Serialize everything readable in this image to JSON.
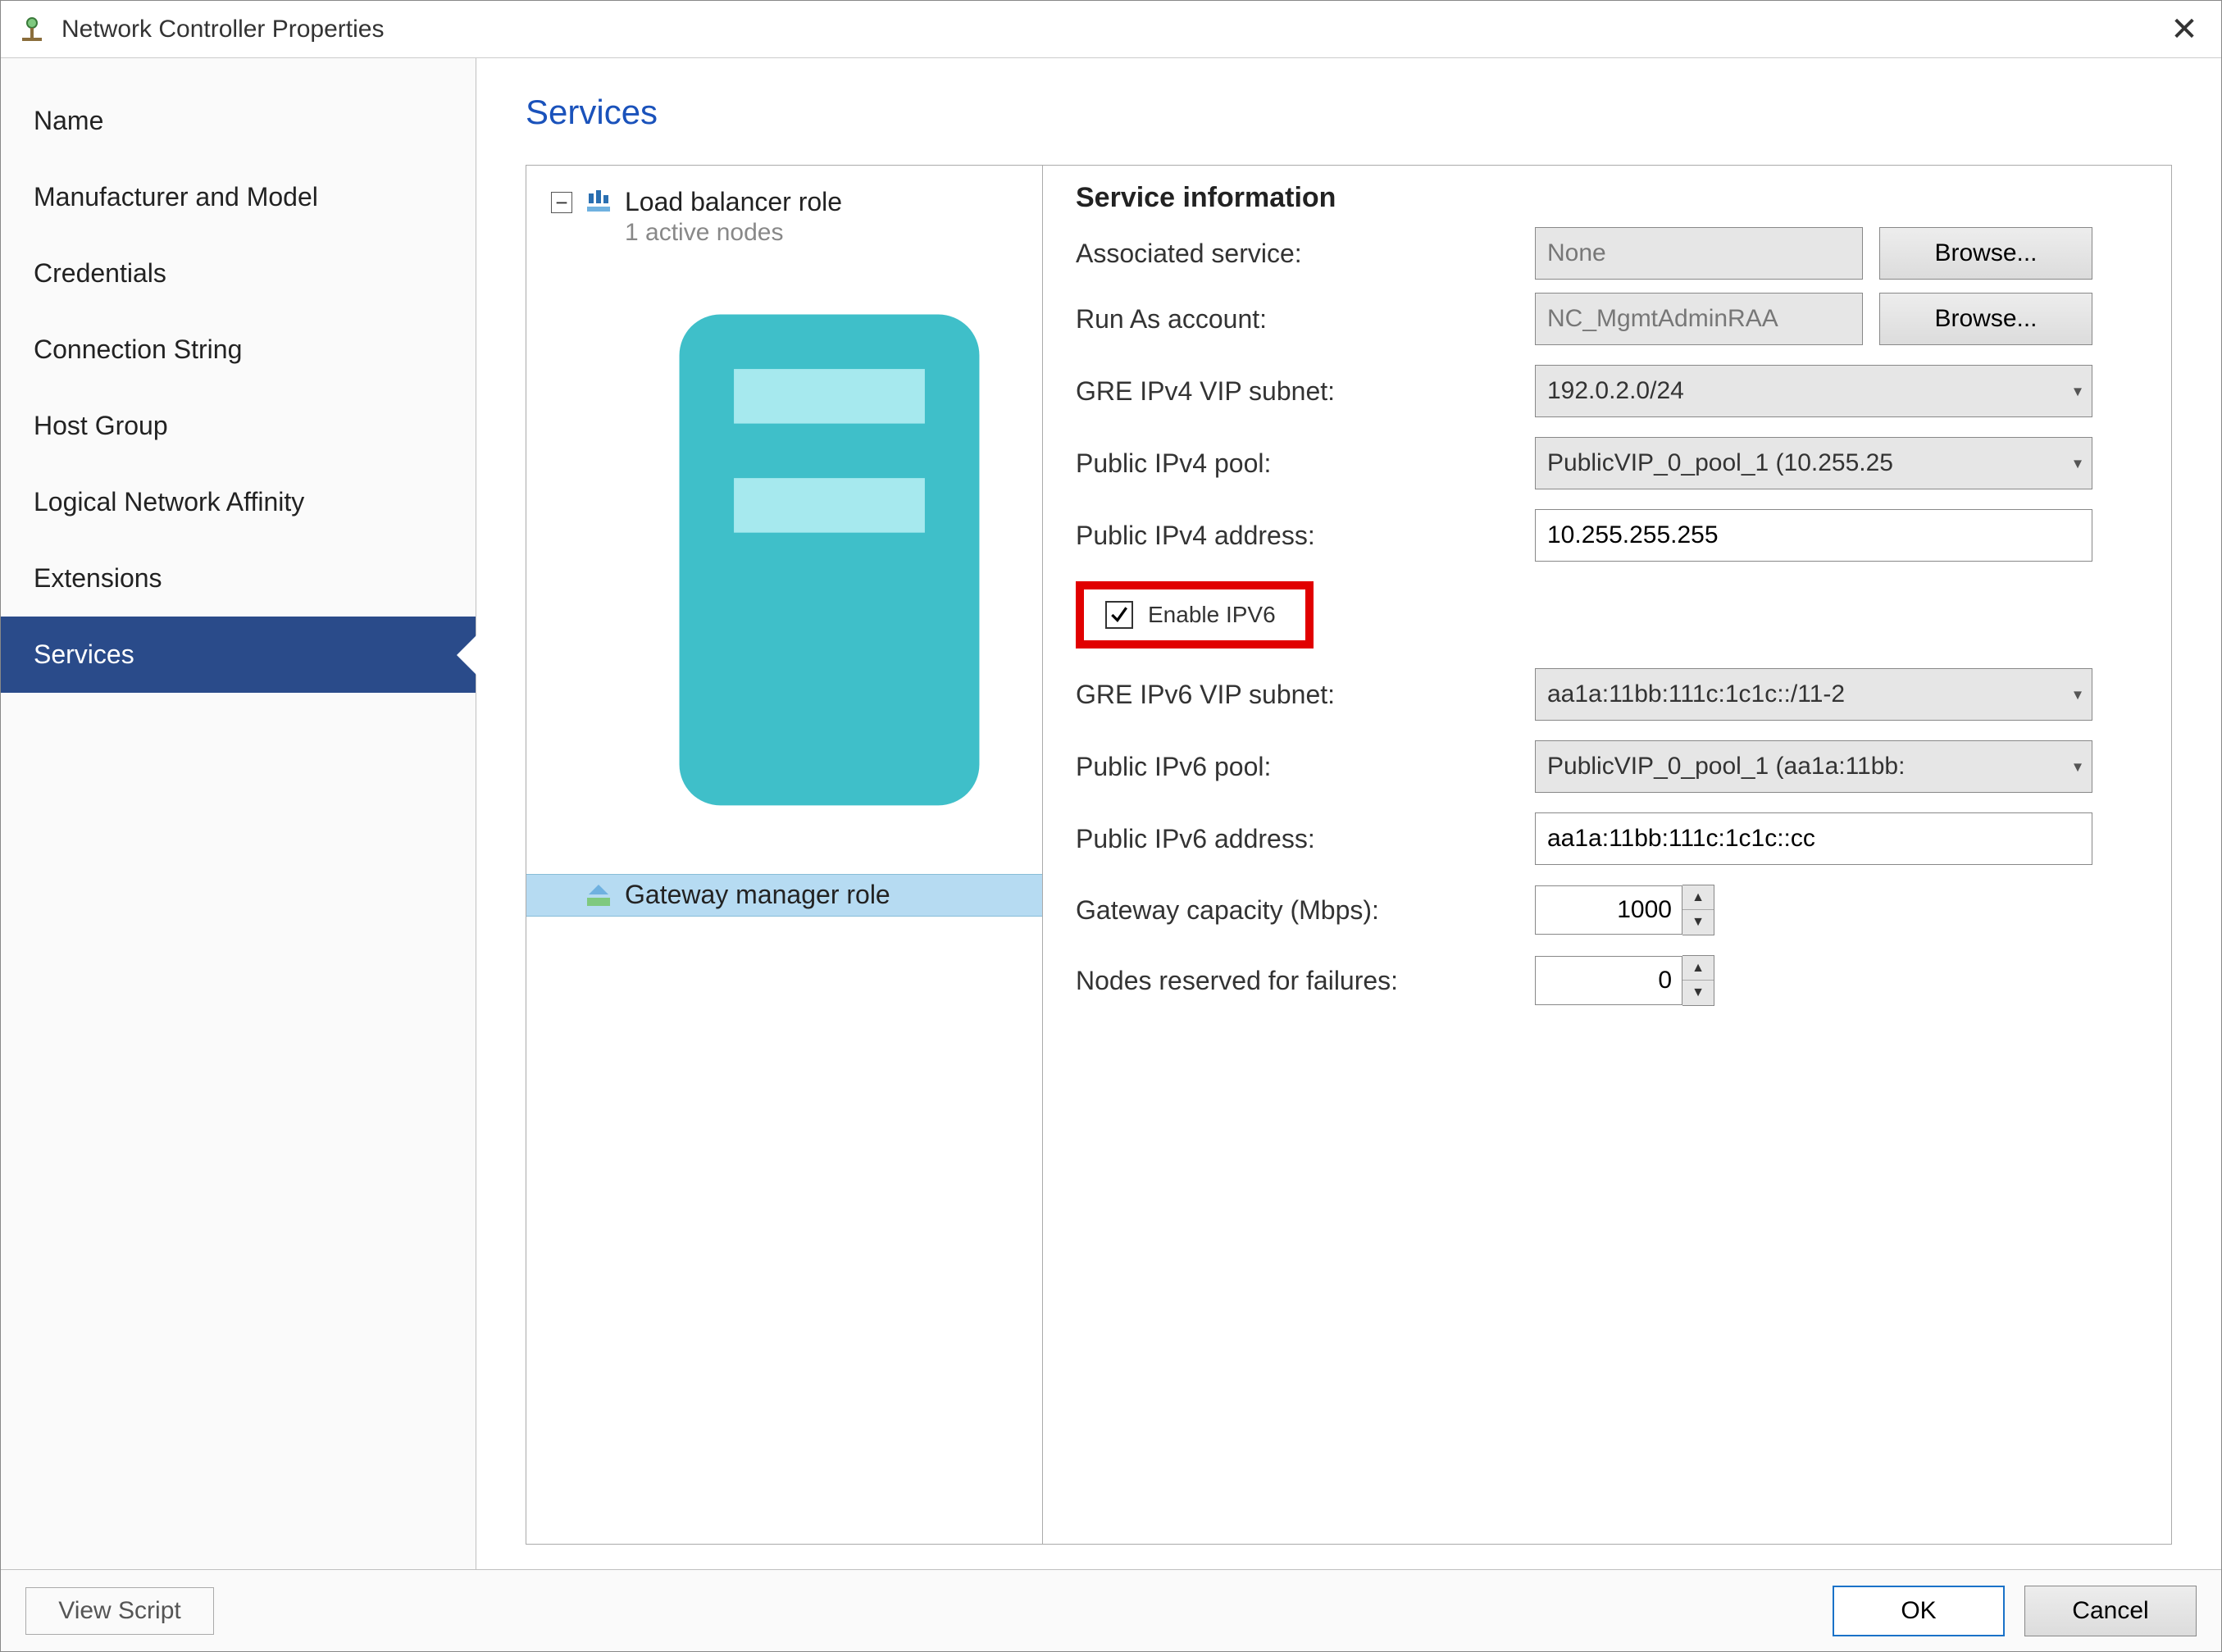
{
  "window": {
    "title": "Network Controller Properties"
  },
  "sidebar": {
    "items": [
      {
        "label": "Name"
      },
      {
        "label": "Manufacturer and Model"
      },
      {
        "label": "Credentials"
      },
      {
        "label": "Connection String"
      },
      {
        "label": "Host Group"
      },
      {
        "label": "Logical Network Affinity"
      },
      {
        "label": "Extensions"
      },
      {
        "label": "Services",
        "selected": true
      }
    ]
  },
  "content": {
    "title": "Services",
    "tree": {
      "loadBalancer": {
        "label": "Load balancer role",
        "sublabel": "1 active nodes"
      },
      "gatewayManager": {
        "label": "Gateway manager role"
      }
    },
    "detail": {
      "heading": "Service information",
      "associatedService": {
        "label": "Associated service:",
        "value": "None",
        "browse": "Browse..."
      },
      "runAsAccount": {
        "label": "Run As account:",
        "value": "NC_MgmtAdminRAA",
        "browse": "Browse..."
      },
      "greIpv4Subnet": {
        "label": "GRE IPv4 VIP subnet:",
        "value": "192.0.2.0/24"
      },
      "publicIpv4Pool": {
        "label": "Public IPv4 pool:",
        "value": "PublicVIP_0_pool_1 (10.255.25"
      },
      "publicIpv4Addr": {
        "label": "Public IPv4 address:",
        "value": "10.255.255.255"
      },
      "enableIpv6": {
        "label": "Enable IPV6",
        "checked": true
      },
      "greIpv6Subnet": {
        "label": "GRE IPv6 VIP subnet:",
        "value": "aa1a:11bb:111c:1c1c::/11-2"
      },
      "publicIpv6Pool": {
        "label": "Public IPv6 pool:",
        "value": "PublicVIP_0_pool_1 (aa1a:11bb:"
      },
      "publicIpv6Addr": {
        "label": "Public IPv6 address:",
        "value": "aa1a:11bb:111c:1c1c::cc"
      },
      "gatewayCapacity": {
        "label": "Gateway capacity (Mbps):",
        "value": "1000"
      },
      "nodesReserved": {
        "label": "Nodes reserved for failures:",
        "value": "0"
      }
    }
  },
  "footer": {
    "viewScript": "View Script",
    "ok": "OK",
    "cancel": "Cancel"
  }
}
